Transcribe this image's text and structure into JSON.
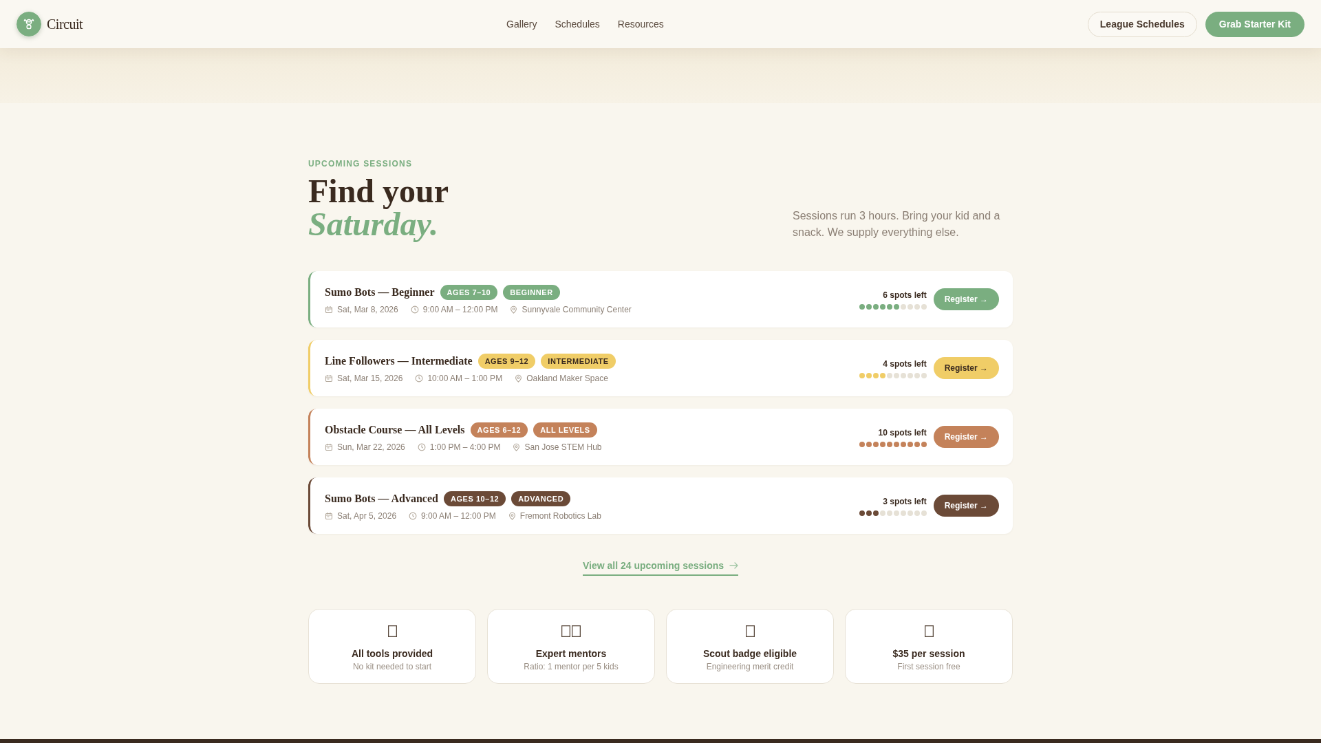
{
  "header": {
    "brand": "Circuit",
    "nav": [
      "Gallery",
      "Schedules",
      "Resources"
    ],
    "buttons": [
      {
        "label": "League Schedules",
        "kind": "outline"
      },
      {
        "label": "Grab Starter Kit",
        "kind": "primary"
      }
    ]
  },
  "intro": {
    "eyebrow": "UPCOMING SESSIONS",
    "heading": "Find your *Saturday.*",
    "description": "Sessions run 3 hours. Bring your kid and a snack. We supply everything else."
  },
  "sessions": [
    {
      "title": "Sumo Bots — Beginner",
      "color": "#7aae80",
      "tags": [
        "AGES 7–10",
        "BEGINNER"
      ],
      "date": "Sat, Mar 8, 2026",
      "time": "9:00 AM – 12:00 PM",
      "location": "Sunnyvale Community Center",
      "spots": "6 spots left",
      "stars": 6,
      "button": "Register →"
    },
    {
      "title": "Line Followers — Intermediate",
      "color": "#f0cd67",
      "tags": [
        "AGES 9–12",
        "INTERMEDIATE"
      ],
      "date": "Sat, Mar 15, 2026",
      "time": "10:00 AM – 1:00 PM",
      "location": "Oakland Maker Space",
      "spots": "4 spots left",
      "stars": 4,
      "button": "Register →"
    },
    {
      "title": "Obstacle Course — All Levels",
      "color": "#c4825a",
      "tags": [
        "AGES 6–12",
        "ALL LEVELS"
      ],
      "date": "Sun, Mar 22, 2026",
      "time": "1:00 PM – 4:00 PM",
      "location": "San Jose STEM Hub",
      "spots": "10 spots left",
      "stars": 10,
      "button": "Register →"
    },
    {
      "title": "Sumo Bots — Advanced",
      "color": "#6b4a37",
      "tags": [
        "AGES 10–12",
        "ADVANCED"
      ],
      "date": "Sat, Apr 5, 2026",
      "time": "9:00 AM – 12:00 PM",
      "location": "Fremont Robotics Lab",
      "spots": "3 spots left",
      "stars": 3,
      "button": "Register →"
    }
  ],
  "view_all": "View all 24 upcoming sessions",
  "features": [
    {
      "kind": "single",
      "title": "All tools provided",
      "subtitle": "No kit needed to start"
    },
    {
      "kind": "double",
      "title": "Expert mentors",
      "subtitle": "Ratio: 1 mentor per 5 kids"
    },
    {
      "kind": "single",
      "title": "Scout badge eligible",
      "subtitle": "Engineering merit credit"
    },
    {
      "kind": "single",
      "title": "$35 per session",
      "subtitle": "First session free"
    }
  ]
}
